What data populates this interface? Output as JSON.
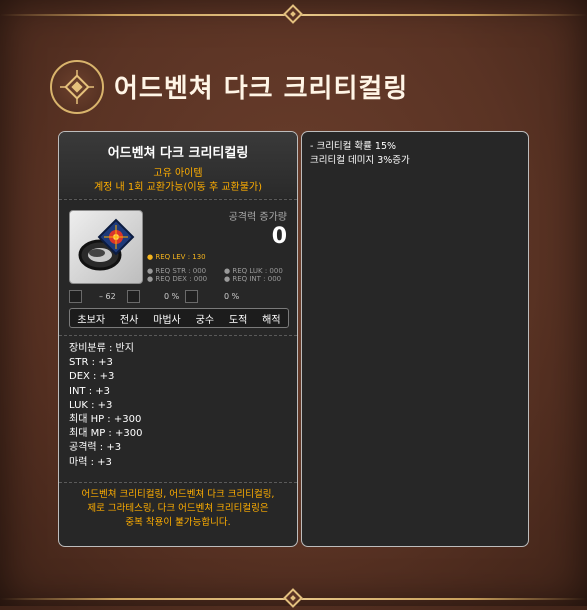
{
  "page": {
    "title": "어드벤쳐 다크 크리티컬링"
  },
  "tooltip": {
    "item_name": "어드벤쳐 다크 크리티컬링",
    "grade": "고유 아이템",
    "trade": "계정 내 1회 교환가능(이동 후 교환불가)",
    "attack_increase_label": "공격력 증가량",
    "attack_increase_value": "0",
    "req_level": "● REQ LEV : 130",
    "req_str": "● REQ STR : 000",
    "req_luk": "● REQ LUK : 000",
    "req_dex": "● REQ DEX : 000",
    "req_int": "● REQ INT : 000",
    "small_stats": [
      {
        "label": "– 62",
        "icon": "gear-icon"
      },
      {
        "label": "0 %",
        "icon": "scroll-icon"
      },
      {
        "label": "0 %",
        "icon": "shield-icon"
      }
    ],
    "jobs": [
      "초보자",
      "전사",
      "마법사",
      "궁수",
      "도적",
      "해적"
    ],
    "stats": [
      "장비분류 : 반지",
      "STR : +3",
      "DEX : +3",
      "INT : +3",
      "LUK : +3",
      "최대 HP : +300",
      "최대 MP : +300",
      "공격력 : +3",
      "마력 : +3"
    ],
    "description": [
      "어드벤쳐 크리티컬링, 어드벤쳐 다크 크리티컬링,",
      "제로 그라테스링, 다크 어드벤쳐 크리티컬링은",
      "중복 착용이 불가능합니다."
    ]
  },
  "effects": {
    "lines": [
      "- 크리티컬 확률 15%",
      "크리티컬 데미지 3%증가"
    ]
  },
  "colors": {
    "background": "#5a3324",
    "gold": "#d9b46c",
    "tooltip_bg": "#272727",
    "orange_text": "#ffae00"
  }
}
